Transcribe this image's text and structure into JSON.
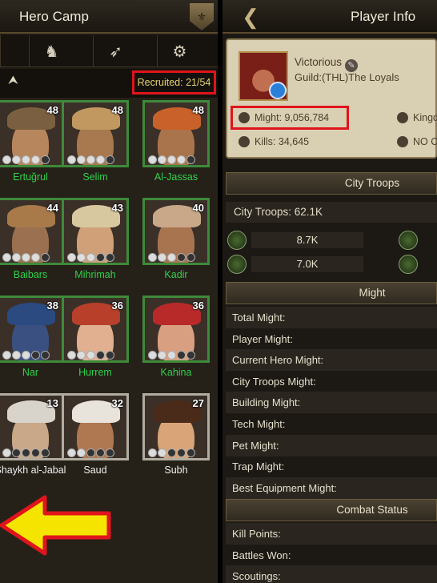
{
  "left": {
    "title": "Hero Camp",
    "tabs": [
      "all-heroes-icon",
      "horse-icon",
      "bow-icon",
      "siege-icon"
    ],
    "sort_glyph": "⮝",
    "recruited": "Recruited: 21/54",
    "heroes": [
      {
        "name": "Ertuğrul",
        "level": "48",
        "stars": 5,
        "on": 4,
        "turban": "#7a6040",
        "skin": "#b8865c",
        "frame": "green"
      },
      {
        "name": "Selim",
        "level": "48",
        "stars": 5,
        "on": 4,
        "turban": "#c09860",
        "skin": "#a8784e",
        "frame": "green"
      },
      {
        "name": "Al-Jassas",
        "level": "48",
        "stars": 5,
        "on": 4,
        "turban": "#c8612a",
        "skin": "#a9744c",
        "frame": "green"
      },
      {
        "name": "Baibars",
        "level": "44",
        "stars": 5,
        "on": 4,
        "turban": "#a87a4a",
        "skin": "#9a7050",
        "frame": "green"
      },
      {
        "name": "Mihrimah",
        "level": "43",
        "stars": 5,
        "on": 3,
        "turban": "#d8c8a0",
        "skin": "#d0a078",
        "frame": "green"
      },
      {
        "name": "Kadir",
        "level": "40",
        "stars": 5,
        "on": 3,
        "turban": "#c8a888",
        "skin": "#a87450",
        "frame": "green"
      },
      {
        "name": "Nar",
        "level": "38",
        "stars": 5,
        "on": 3,
        "turban": "#2a4a80",
        "skin": "#3a5080",
        "frame": "green"
      },
      {
        "name": "Hurrem",
        "level": "36",
        "stars": 5,
        "on": 3,
        "turban": "#b8402a",
        "skin": "#e0b090",
        "frame": "green"
      },
      {
        "name": "Kahina",
        "level": "36",
        "stars": 5,
        "on": 3,
        "turban": "#b82a2a",
        "skin": "#d8a080",
        "frame": "green"
      },
      {
        "name": "Shaykh al-Jabal",
        "level": "13",
        "stars": 5,
        "on": 1,
        "turban": "#d8d4cc",
        "skin": "#c8a888",
        "frame": "white"
      },
      {
        "name": "Saud",
        "level": "32",
        "stars": 5,
        "on": 2,
        "turban": "#e8e4dc",
        "skin": "#b07850",
        "frame": "white"
      },
      {
        "name": "Subh",
        "level": "27",
        "stars": 5,
        "on": 2,
        "turban": "#4a2a18",
        "skin": "#d8a478",
        "frame": "white"
      }
    ]
  },
  "right": {
    "title": "Player Info",
    "rank": "Victorious",
    "guild": "Guild:(THL)The Loyals",
    "might": "Might: 9,056,784",
    "kingdom": "Kingd",
    "kills": "Kills: 34,645",
    "no": "NO C",
    "city_troops_header": "City Troops",
    "city_troops_total": "City Troops: 62.1K",
    "troops": [
      {
        "icon": "cavalry-icon",
        "value": "8.7K"
      },
      {
        "icon": "infantry-icon",
        "value": "7.0K"
      }
    ],
    "might_header": "Might",
    "might_rows": [
      "Total Might:",
      "Player Might:",
      "Current Hero Might:",
      "City Troops Might:",
      "Building Might:",
      "Tech Might:",
      "Pet Might:",
      "Trap Might:",
      "Best Equipment Might:"
    ],
    "combat_header": "Combat Status",
    "combat_rows": [
      "Kill Points:",
      "Battles Won:",
      "Scoutings:"
    ]
  },
  "colors": {
    "highlight": "#e0141c",
    "green_frame": "#3e8a3a",
    "name_green": "#2fd04a",
    "arrow_yellow": "#f5e400"
  }
}
